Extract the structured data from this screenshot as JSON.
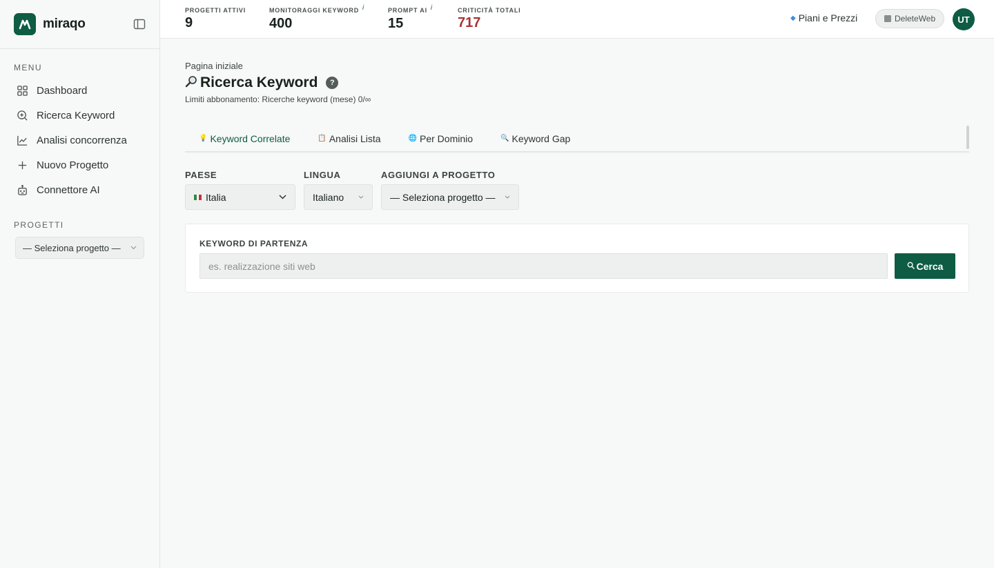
{
  "brand": {
    "name": "miraqo"
  },
  "sidebar": {
    "menu_title": "MENU",
    "items": [
      {
        "label": "Dashboard",
        "icon": "grid-icon"
      },
      {
        "label": "Ricerca Keyword",
        "icon": "search-icon"
      },
      {
        "label": "Analisi concorrenza",
        "icon": "chart-line-icon"
      },
      {
        "label": "Nuovo Progetto",
        "icon": "plus-icon"
      },
      {
        "label": "Connettore AI",
        "icon": "robot-icon"
      }
    ],
    "projects_title": "PROGETTI",
    "project_select": "— Seleziona progetto —"
  },
  "topbar": {
    "stats": [
      {
        "label": "PROGETTI ATTIVI",
        "value": "9",
        "info": ""
      },
      {
        "label": "MONITORAGGI KEYWORD",
        "value": "400",
        "info": "i"
      },
      {
        "label": "PROMPT AI",
        "value": "15",
        "info": "i"
      },
      {
        "label": "CRITICITÀ TOTALI",
        "value": "717",
        "info": ""
      }
    ],
    "pricing_label": "Piani e Prezzi",
    "workspace": "DeleteWeb",
    "avatar": "UT",
    "colors": {
      "brand": "#0d5c43",
      "critical": "#a83232"
    }
  },
  "page": {
    "breadcrumb": "Pagina iniziale",
    "title": "Ricerca Keyword",
    "help": "?",
    "limits": "Limiti abbonamento: Ricerche keyword (mese) 0/∞",
    "tabs": [
      {
        "label": "Keyword Correlate",
        "icon": "lightbulb-icon",
        "glyph": "💡"
      },
      {
        "label": "Analisi Lista",
        "icon": "clipboard-icon",
        "glyph": "📋"
      },
      {
        "label": "Per Dominio",
        "icon": "globe-icon",
        "glyph": "🌐"
      },
      {
        "label": "Keyword Gap",
        "icon": "magnifier-icon",
        "glyph": "🔍"
      }
    ],
    "filters": {
      "country_label": "PAESE",
      "country_value": "Italia",
      "language_label": "LINGUA",
      "language_value": "Italiano",
      "project_label": "AGGIUNGI A PROGETTO",
      "project_value": "— Seleziona progetto —"
    },
    "search": {
      "label": "KEYWORD DI PARTENZA",
      "placeholder": "es. realizzazione siti web",
      "value": "",
      "button": "Cerca"
    }
  }
}
